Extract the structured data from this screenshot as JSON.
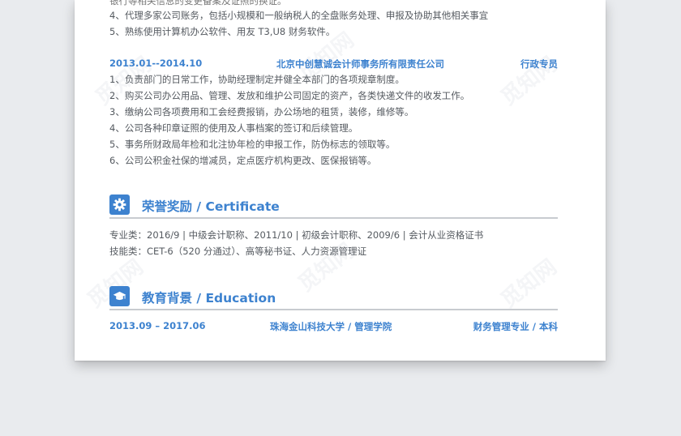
{
  "experience": {
    "clipped_line": "银行等相关信息的变更备案及证照的换证。",
    "prev_items": [
      "4、代理多家公司账务，包括小规模和一般纳税人的全盘账务处理、申报及协助其他相关事宜",
      "5、熟练使用计算机办公软件、用友 T3,U8 财务软件。"
    ],
    "job": {
      "period": "2013.01--2014.10",
      "company": "北京中创慧诚会计师事务所有限责任公司",
      "title": "行政专员",
      "items": [
        "1、负责部门的日常工作，协助经理制定并健全本部门的各项规章制度。",
        "2、购买公司办公用品、管理、发放和维护公司固定的资产，各类快递文件的收发工作。",
        "3、缴纳公司各项费用和工会经费报销，办公场地的租赁，装修，维修等。",
        "4、公司各种印章证照的使用及人事档案的签订和后续管理。",
        "5、事务所财政局年检和北注协年检的申报工作，防伪标志的领取等。",
        "6、公司公积金社保的增减员，定点医疗机构更改、医保报销等。"
      ]
    }
  },
  "honors": {
    "icon": "gear-icon",
    "title": "荣誉奖励 / Certificate",
    "lines": [
      "专业类：2016/9 | 中级会计职称、2011/10 | 初级会计职称、2009/6 | 会计从业资格证书",
      "技能类：CET-6（520 分通过）、高等秘书证、人力资源管理证"
    ]
  },
  "education": {
    "icon": "graduation-cap-icon",
    "title": "教育背景 / Education",
    "period": "2013.09 – 2017.06",
    "school": "珠海金山科技大学 / 管理学院",
    "major": "财务管理专业 / 本科"
  },
  "watermark": "觅知网",
  "colors": {
    "accent": "#3d82cf",
    "text": "#555a60",
    "rule": "#c8cbd0",
    "background": "#e9ebee"
  }
}
